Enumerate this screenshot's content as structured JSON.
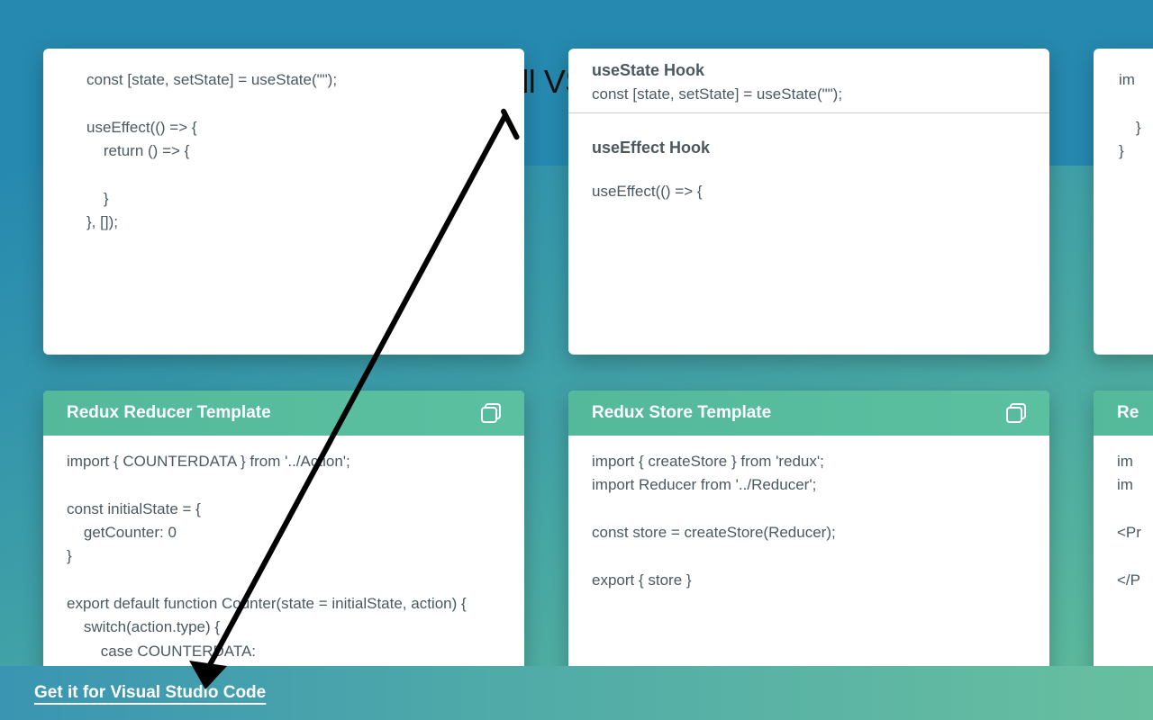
{
  "banner": {
    "headline": "Click to install VSCode Extension"
  },
  "footer": {
    "cta": "Get it for Visual Studio Code"
  },
  "cards": {
    "topLeft": {
      "code": "const [state, setState] = useState(\"\");\n\nuseEffect(() => {\n    return () => {\n\n    }\n}, []);"
    },
    "topRight": {
      "sections": [
        {
          "title": "useState Hook",
          "code": "const [state, setState] = useState(\"\");"
        },
        {
          "title": "useEffect Hook",
          "code": "useEffect(() => {"
        }
      ]
    },
    "topFar": {
      "code": "im\n\n    }\n}"
    },
    "reducer": {
      "title": "Redux Reducer Template",
      "code": "import { COUNTERDATA } from '../Action';\n\nconst initialState = {\n    getCounter: 0\n}\n\nexport default function Counter(state = initialState, action) {\n    switch(action.type) {\n        case COUNTERDATA:"
    },
    "store": {
      "title": "Redux Store Template",
      "code": "import { createStore } from 'redux';\nimport Reducer from '../Reducer';\n\nconst store = createStore(Reducer);\n\nexport { store }"
    },
    "bottomFar": {
      "title": "Re",
      "code": "im\nim\n\n<Pr\n\n</P"
    }
  }
}
